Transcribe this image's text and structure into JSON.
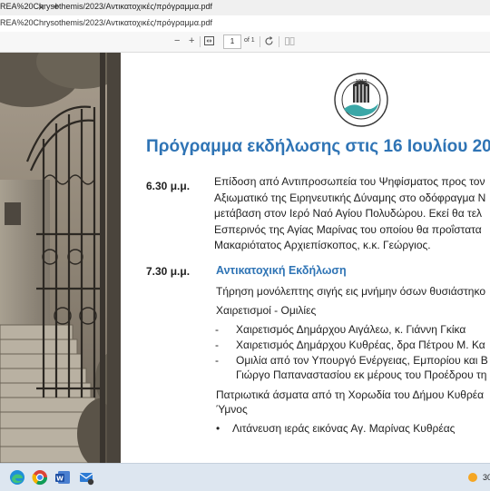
{
  "browser": {
    "tab_title": "REA%20Chrysothemis/2023/Αντικατοχικές/πρόγραμμα.pdf",
    "address": "REA%20Chrysothemis/2023/Αντικατοχικές/πρόγραμμα.pdf",
    "tab_close": "×",
    "tab_add": "+"
  },
  "pdf_toolbar": {
    "zoom_out": "−",
    "zoom_in": "+",
    "page_number": "1",
    "page_of": "of 1"
  },
  "document": {
    "emblem_text": "ΔΗΜΟΣ ΚΥΘΡΕΑΣ",
    "emblem_year": "1912",
    "title": "Πρόγραμμα εκδήλωσης στις 16 Ιουλίου 20",
    "block1": {
      "time": "6.30 μ.μ.",
      "lines": [
        "Επίδοση από Αντιπροσωπεία του Ψηφίσματος προς τον",
        "Αξιωματικό της Ειρηνευτικής Δύναμης στο οδόφραγμα Ν",
        "μετάβαση στον Ιερό Ναό Αγίου Πολυδώρου. Εκεί θα τελ",
        "Εσπερινός της Αγίας Μαρίνας του οποίου θα προΐστατα",
        "Μακαριότατος Αρχιεπίσκοπος, κ.κ. Γεώργιος."
      ]
    },
    "block2": {
      "time": "7.30 μ.μ.",
      "heading": "Αντικατοχική Εκδήλωση",
      "silence": "Τήρηση μονόλεπτης σιγής εις μνήμην όσων θυσιάστηκο",
      "greetings_heading": "Χαιρετισμοί - Ομιλίες",
      "dash_items": [
        "Χαιρετισμός Δημάρχου Αιγάλεω, κ. Γιάννη Γκίκα",
        "Χαιρετισμός Δημάρχου Κυθρέας, δρα Πέτρου Μ. Κα",
        "Ομιλία  από τον Υπουργό Ενέργειας, Εμπορίου και Β"
      ],
      "dash_continuation": "Γιώργο Παπαναστασίου εκ μέρους του Προέδρου τη",
      "songs_line1": "Πατριωτικά άσματα από τη Χορωδία του Δήμου Κυθρέα",
      "songs_line2": "Ύμνος",
      "bullet_item": "Λιτάνευση ιεράς εικόνας Αγ. Μαρίνας Κυθρέας"
    }
  },
  "taskbar": {
    "tray_text": "30"
  },
  "colors": {
    "title_blue": "#2f74b5",
    "taskbar": "#dde6f0"
  }
}
